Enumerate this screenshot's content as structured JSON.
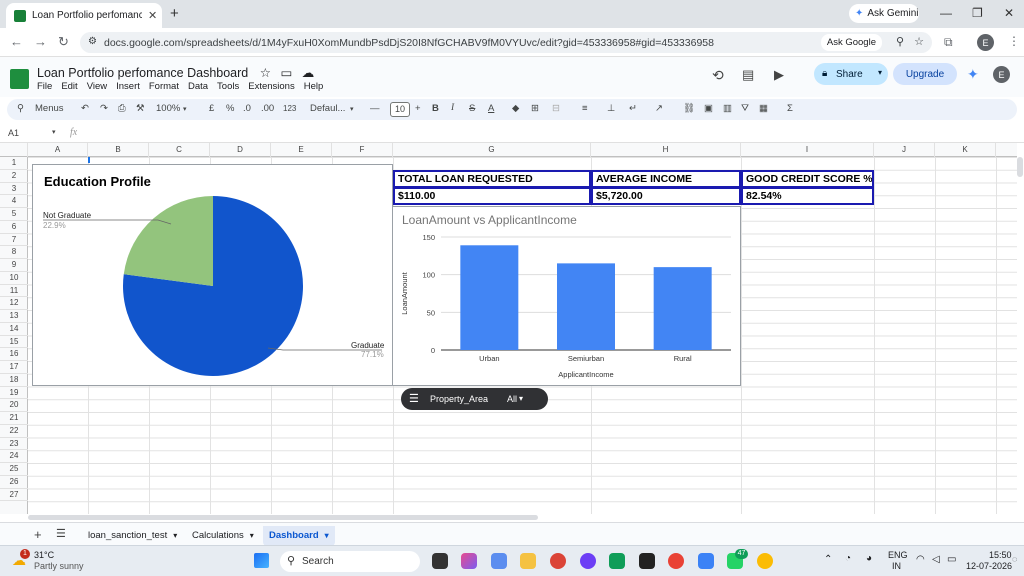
{
  "browser": {
    "tab_title": "Loan Portfolio perfomance Dashb",
    "ask_gemini": "Ask Gemini",
    "url": "docs.google.com/spreadsheets/d/1M4yFxuH0XomMundbPsdDjS20I8NfGCHABV9fM0VYUvc/edit?gid=453336958#gid=453336958",
    "ask_google": "Ask Google",
    "profile_initial": "E"
  },
  "doc": {
    "title": "Loan Portfolio perfomance Dashboard",
    "menus": [
      "File",
      "Edit",
      "View",
      "Insert",
      "Format",
      "Data",
      "Tools",
      "Extensions",
      "Help"
    ],
    "share_label": "Share",
    "upgrade_label": "Upgrade",
    "profile_initial": "E"
  },
  "toolbar": {
    "menus_label": "Menus",
    "zoom": "100%",
    "currency": "£",
    "percent": "%",
    "dec_decrease": ".0",
    "dec_increase": ".00",
    "number_format": "123",
    "font": "Defaul...",
    "font_size": "10",
    "bold": "B",
    "italic": "I"
  },
  "formula_bar": {
    "cell_ref": "A1",
    "fx": "fx"
  },
  "grid": {
    "columns": [
      "A",
      "B",
      "C",
      "D",
      "E",
      "F",
      "G",
      "H",
      "I",
      "J",
      "K"
    ],
    "rows": [
      "1",
      "2",
      "3",
      "4",
      "5",
      "6",
      "7",
      "8",
      "9",
      "10",
      "11",
      "12",
      "13",
      "14",
      "15",
      "16",
      "17",
      "18",
      "19",
      "20",
      "21",
      "22",
      "23",
      "24",
      "25",
      "26",
      "27"
    ]
  },
  "kpis": {
    "headers": [
      "TOTAL LOAN REQUESTED",
      "AVERAGE INCOME",
      "GOOD CREDIT SCORE %"
    ],
    "values": [
      "$110.00",
      "$5,720.00",
      "82.54%"
    ]
  },
  "chart_data": [
    {
      "type": "pie",
      "title": "Education Profile",
      "labels": [
        "Graduate",
        "Not Graduate"
      ],
      "values": [
        77.1,
        22.9
      ],
      "percent_labels": [
        "77.1%",
        "22.9%"
      ],
      "colors": [
        "#1155cc",
        "#93c47d"
      ]
    },
    {
      "type": "bar",
      "title": "LoanAmount vs ApplicantIncome",
      "categories": [
        "Urban",
        "Semiurban",
        "Rural"
      ],
      "values": [
        139,
        115,
        110
      ],
      "xlabel": "ApplicantIncome",
      "ylabel": "LoanAmount",
      "ylim": [
        0,
        150
      ],
      "yticks": [
        0,
        50,
        100,
        150
      ],
      "ytick_labels": [
        "0",
        "50",
        "100",
        "150"
      ],
      "grid": true,
      "color": "#4285f4"
    }
  ],
  "filter": {
    "name": "Property_Area",
    "value": "All"
  },
  "sheet_tabs": [
    "loan_sanction_test",
    "Calculations",
    "Dashboard"
  ],
  "taskbar": {
    "weather_temp": "31°C",
    "weather_desc": "Partly sunny",
    "weather_badge": "1",
    "search": "Search",
    "lang1": "ENG",
    "lang2": "IN",
    "time": "15:50",
    "date": "12-07-2026",
    "whatsapp_badge": "47"
  }
}
